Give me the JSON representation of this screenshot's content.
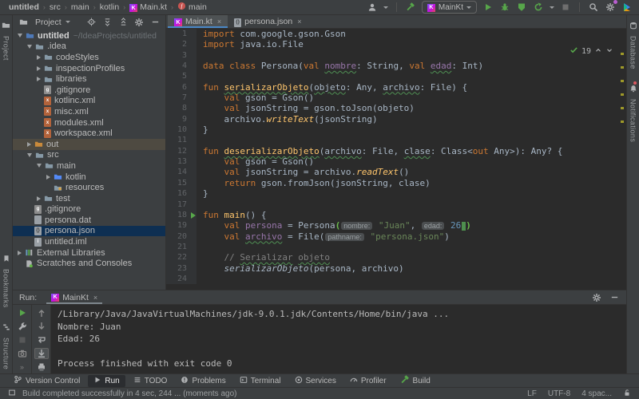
{
  "breadcrumbs": {
    "items": [
      {
        "label": "untitled",
        "icon": null
      },
      {
        "label": "src",
        "icon": null
      },
      {
        "label": "main",
        "icon": null
      },
      {
        "label": "kotlin",
        "icon": null
      },
      {
        "label": "Main.kt",
        "icon": "kotlin-icon"
      },
      {
        "label": "main",
        "icon": "function-icon"
      }
    ]
  },
  "main_toolbar": {
    "items": [
      {
        "name": "user-icon",
        "caret": true
      },
      {
        "name": "divider"
      },
      {
        "name": "build-hammer-icon"
      },
      {
        "name": "run-config-selector",
        "label": "MainKt",
        "caret": true
      },
      {
        "name": "run-icon"
      },
      {
        "name": "debug-icon"
      },
      {
        "name": "coverage-icon"
      },
      {
        "name": "profiler-icon",
        "caret": true
      },
      {
        "name": "stop-icon",
        "disabled": true
      },
      {
        "name": "divider"
      },
      {
        "name": "search-everywhere-icon"
      },
      {
        "name": "settings-gear-icon",
        "badge": true
      },
      {
        "name": "ide-features-icon"
      }
    ]
  },
  "activity_bars": {
    "left_top": [
      {
        "label": "Project",
        "icon": "project-folder-icon"
      }
    ],
    "left_bottom": [
      {
        "label": "Bookmarks",
        "icon": "bookmark-icon"
      },
      {
        "label": "Structure",
        "icon": "structure-icon"
      }
    ],
    "right_top": [
      {
        "label": "Database",
        "icon": "database-icon"
      },
      {
        "label": "Notifications",
        "icon": "bell-icon",
        "badge": true
      }
    ]
  },
  "project_panel": {
    "title": "Project",
    "header_icons": [
      "locate-file-icon",
      "expand-all-icon",
      "collapse-all-icon",
      "settings-gear-icon",
      "hide-panel-icon"
    ],
    "tree": [
      {
        "label": "untitled",
        "depth": 0,
        "arrow": "v",
        "icon": "folder-project",
        "suffix": "~/IdeaProjects/untitled",
        "bold": true
      },
      {
        "label": ".idea",
        "depth": 1,
        "arrow": "v",
        "icon": "folder"
      },
      {
        "label": "codeStyles",
        "depth": 2,
        "arrow": ">",
        "icon": "folder"
      },
      {
        "label": "inspectionProfiles",
        "depth": 2,
        "arrow": ">",
        "icon": "folder"
      },
      {
        "label": "libraries",
        "depth": 2,
        "arrow": ">",
        "icon": "folder"
      },
      {
        "label": ".gitignore",
        "depth": 2,
        "arrow": "",
        "icon": "file-git"
      },
      {
        "label": "kotlinc.xml",
        "depth": 2,
        "arrow": "",
        "icon": "file-xml"
      },
      {
        "label": "misc.xml",
        "depth": 2,
        "arrow": "",
        "icon": "file-xml"
      },
      {
        "label": "modules.xml",
        "depth": 2,
        "arrow": "",
        "icon": "file-xml"
      },
      {
        "label": "workspace.xml",
        "depth": 2,
        "arrow": "",
        "icon": "file-xml"
      },
      {
        "label": "out",
        "depth": 1,
        "arrow": ">",
        "icon": "folder-out",
        "selected": "brown"
      },
      {
        "label": "src",
        "depth": 1,
        "arrow": "v",
        "icon": "folder"
      },
      {
        "label": "main",
        "depth": 2,
        "arrow": "v",
        "icon": "folder"
      },
      {
        "label": "kotlin",
        "depth": 3,
        "arrow": ">",
        "icon": "folder-src"
      },
      {
        "label": "resources",
        "depth": 3,
        "arrow": "",
        "icon": "folder-res"
      },
      {
        "label": "test",
        "depth": 2,
        "arrow": ">",
        "icon": "folder"
      },
      {
        "label": ".gitignore",
        "depth": 1,
        "arrow": "",
        "icon": "file-git"
      },
      {
        "label": "persona.dat",
        "depth": 1,
        "arrow": "",
        "icon": "file-plain"
      },
      {
        "label": "persona.json",
        "depth": 1,
        "arrow": "",
        "icon": "file-json",
        "selected": "blue"
      },
      {
        "label": "untitled.iml",
        "depth": 1,
        "arrow": "",
        "icon": "file-iml"
      },
      {
        "label": "External Libraries",
        "depth": 0,
        "arrow": ">",
        "icon": "library-icon"
      },
      {
        "label": "Scratches and Consoles",
        "depth": 0,
        "arrow": "",
        "icon": "scratch-icon"
      }
    ]
  },
  "editor": {
    "tabs": [
      {
        "label": "Main.kt",
        "icon": "kotlin-icon",
        "active": true,
        "close": "×"
      },
      {
        "label": "persona.json",
        "icon": "json-icon",
        "active": false,
        "close": "×"
      }
    ],
    "inspections": {
      "count": "19"
    },
    "lines": [
      {
        "n": "1",
        "seg": [
          [
            "import",
            "k"
          ],
          [
            " com.google.gson.Gson",
            "t"
          ]
        ]
      },
      {
        "n": "2",
        "seg": [
          [
            "import",
            "k"
          ],
          [
            " java.io.File",
            "t"
          ]
        ]
      },
      {
        "n": "3",
        "seg": []
      },
      {
        "n": "4",
        "seg": [
          [
            "data class",
            "k"
          ],
          [
            " Persona(",
            "t"
          ],
          [
            "val",
            "k"
          ],
          [
            " ",
            "t"
          ],
          [
            "nombre",
            "p u"
          ],
          [
            ": String, ",
            "t"
          ],
          [
            "val",
            "k"
          ],
          [
            " ",
            "t"
          ],
          [
            "edad",
            "p u"
          ],
          [
            ": Int)",
            "t"
          ]
        ]
      },
      {
        "n": "5",
        "seg": []
      },
      {
        "n": "6",
        "seg": [
          [
            "fun",
            "k"
          ],
          [
            " ",
            "t"
          ],
          [
            "serializarObjeto",
            "f u"
          ],
          [
            "(",
            "t"
          ],
          [
            "objeto",
            "t u"
          ],
          [
            ": Any, ",
            "t"
          ],
          [
            "archivo",
            "t u"
          ],
          [
            ": File) {",
            "t"
          ]
        ]
      },
      {
        "n": "7",
        "seg": [
          [
            "    ",
            "t"
          ],
          [
            "val",
            "k"
          ],
          [
            " gson = Gson()",
            "t"
          ]
        ]
      },
      {
        "n": "8",
        "seg": [
          [
            "    ",
            "t"
          ],
          [
            "val",
            "k"
          ],
          [
            " jsonString = gson.toJson(objeto)",
            "t"
          ]
        ]
      },
      {
        "n": "9",
        "seg": [
          [
            "    archivo.",
            "t"
          ],
          [
            "writeText",
            "f i"
          ],
          [
            "(jsonString)",
            "t"
          ]
        ]
      },
      {
        "n": "10",
        "seg": [
          [
            "}",
            "t"
          ]
        ]
      },
      {
        "n": "11",
        "seg": []
      },
      {
        "n": "12",
        "seg": [
          [
            "fun",
            "k"
          ],
          [
            " ",
            "t"
          ],
          [
            "deserializarObjeto",
            "f u"
          ],
          [
            "(",
            "t"
          ],
          [
            "archivo",
            "t u"
          ],
          [
            ": File, ",
            "t"
          ],
          [
            "clase",
            "t u"
          ],
          [
            ": Class<",
            "t"
          ],
          [
            "out",
            "k"
          ],
          [
            " Any>): Any? {",
            "t"
          ]
        ]
      },
      {
        "n": "13",
        "seg": [
          [
            "    ",
            "t"
          ],
          [
            "val",
            "k"
          ],
          [
            " gson = Gson()",
            "t"
          ]
        ]
      },
      {
        "n": "14",
        "seg": [
          [
            "    ",
            "t"
          ],
          [
            "val",
            "k"
          ],
          [
            " jsonString = archivo.",
            "t"
          ],
          [
            "readText",
            "f i"
          ],
          [
            "()",
            "t"
          ]
        ]
      },
      {
        "n": "15",
        "seg": [
          [
            "    ",
            "t"
          ],
          [
            "return",
            "k"
          ],
          [
            " gson.fromJson(jsonString, clase)",
            "t"
          ]
        ]
      },
      {
        "n": "16",
        "seg": [
          [
            "}",
            "t"
          ]
        ]
      },
      {
        "n": "17",
        "seg": []
      },
      {
        "n": "18",
        "run": true,
        "seg": [
          [
            "fun",
            "k"
          ],
          [
            " ",
            "t"
          ],
          [
            "main",
            "f"
          ],
          [
            "() {",
            "t"
          ]
        ]
      },
      {
        "n": "19",
        "seg": [
          [
            "    ",
            "t"
          ],
          [
            "val",
            "k"
          ],
          [
            " ",
            "t"
          ],
          [
            "persona",
            "p"
          ],
          [
            " = Persona",
            "t"
          ],
          [
            "(",
            "paren"
          ],
          [
            "nombre:",
            "hint"
          ],
          [
            " ",
            "t"
          ],
          [
            "\"Juan\"",
            "s"
          ],
          [
            ", ",
            "t"
          ],
          [
            "edad:",
            "hint"
          ],
          [
            " ",
            "t"
          ],
          [
            "26",
            "n"
          ],
          [
            "",
            "caret"
          ],
          [
            ")",
            "paren"
          ]
        ]
      },
      {
        "n": "20",
        "seg": [
          [
            "    ",
            "t"
          ],
          [
            "val",
            "k"
          ],
          [
            " ",
            "t"
          ],
          [
            "archivo",
            "p u"
          ],
          [
            " = File(",
            "t"
          ],
          [
            "pathname:",
            "hint"
          ],
          [
            " ",
            "t"
          ],
          [
            "\"persona.json\"",
            "s"
          ],
          [
            ")",
            "t"
          ]
        ]
      },
      {
        "n": "21",
        "seg": []
      },
      {
        "n": "22",
        "seg": [
          [
            "    ",
            "t"
          ],
          [
            "// ",
            "c"
          ],
          [
            "Serializar",
            "c u"
          ],
          [
            " ",
            "c"
          ],
          [
            "objeto",
            "c u"
          ]
        ]
      },
      {
        "n": "23",
        "seg": [
          [
            "    ",
            "t"
          ],
          [
            "serializarObjeto",
            "t i"
          ],
          [
            "(persona, archivo)",
            "t"
          ]
        ]
      },
      {
        "n": "24",
        "seg": []
      }
    ]
  },
  "run_panel": {
    "label": "Run:",
    "tab": {
      "label": "MainKt",
      "icon": "kotlin-icon",
      "close": "×"
    },
    "toolbar_left": [
      {
        "name": "rerun-icon"
      },
      {
        "name": "run-settings-wrench-icon"
      },
      {
        "name": "stop-icon",
        "disabled": true
      },
      {
        "name": "screenshot-icon"
      },
      {
        "name": "more-icon",
        "glyph": "»"
      }
    ],
    "toolbar_inner": [
      {
        "name": "up-stacktrace-icon"
      },
      {
        "name": "down-stacktrace-icon"
      },
      {
        "name": "soft-wrap-icon"
      },
      {
        "name": "scroll-to-end-icon",
        "selected": true
      },
      {
        "name": "print-icon"
      },
      {
        "name": "more-icon",
        "glyph": "»"
      }
    ],
    "header_icons": [
      "settings-gear-icon",
      "hide-panel-icon"
    ],
    "console": [
      "/Library/Java/JavaVirtualMachines/jdk-9.0.1.jdk/Contents/Home/bin/java ...",
      "Nombre: Juan",
      "Edad: 26",
      "",
      "Process finished with exit code 0"
    ]
  },
  "toolwindow_bar": {
    "items": [
      {
        "label": "Version Control",
        "icon": "branch-icon"
      },
      {
        "label": "Run",
        "icon": "play-icon",
        "active": true
      },
      {
        "label": "TODO",
        "icon": "todo-icon"
      },
      {
        "label": "Problems",
        "icon": "problems-icon"
      },
      {
        "label": "Terminal",
        "icon": "terminal-icon"
      },
      {
        "label": "Services",
        "icon": "services-icon"
      },
      {
        "label": "Profiler",
        "icon": "profiler-gauge-icon"
      },
      {
        "label": "Build",
        "icon": "build-hammer-icon"
      }
    ]
  },
  "status_bar": {
    "message": "Build completed successfully in 4 sec, 244 ... (moments ago)",
    "right_items": [
      {
        "name": "line-ending",
        "label": "LF"
      },
      {
        "name": "encoding",
        "label": "UTF-8"
      },
      {
        "name": "indent",
        "label": "4 spac..."
      }
    ]
  },
  "colors": {
    "accent_blue": "#4A88C7",
    "keyword_orange": "#CC7832",
    "string_green": "#6A8759",
    "number_blue": "#6897BB",
    "comment_gray": "#808080",
    "function_yellow": "#FFC66D",
    "property_purple": "#9876AA",
    "run_green": "#57A64A",
    "editor_bg": "#2B2B2B",
    "panel_bg": "#3C3F41",
    "selection_blue": "#0E2F52",
    "selection_brown": "#4E4A41"
  }
}
